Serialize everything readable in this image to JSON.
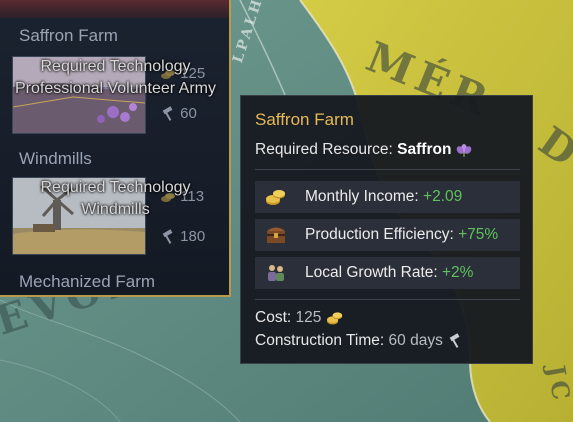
{
  "map": {
    "labels": [
      "MÉR",
      "D",
      "EVORA",
      "LPALH",
      "JC"
    ]
  },
  "building_list": {
    "items": [
      {
        "title": "Saffron Farm",
        "cost": "125",
        "time": "60",
        "locked_title": "Required Technology",
        "locked_requirement": "Professional Volunteer Army"
      },
      {
        "title": "Windmills",
        "cost": "113",
        "time": "180",
        "locked_title": "Required Technology",
        "locked_requirement": "Windmills"
      },
      {
        "title": "Mechanized Farm"
      }
    ]
  },
  "tooltip": {
    "title": "Saffron Farm",
    "required_resource_label": "Required Resource:",
    "required_resource_value": "Saffron",
    "modifiers": [
      {
        "label": "Monthly Income:",
        "value": "+2.09",
        "icon": "gold-coins-icon"
      },
      {
        "label": "Production Efficiency:",
        "value": "+75%",
        "icon": "treasure-chest-icon"
      },
      {
        "label": "Local Growth Rate:",
        "value": "+2%",
        "icon": "population-icon"
      }
    ],
    "cost_label": "Cost:",
    "cost_value": "125",
    "construction_label": "Construction Time:",
    "construction_value": "60 days"
  },
  "colors": {
    "tooltip_title": "#e6b955",
    "positive_value": "#5fc25c",
    "panel_border": "#b89a4a",
    "map_yellow": "#c9c23a",
    "map_teal": "#5d8a82"
  }
}
